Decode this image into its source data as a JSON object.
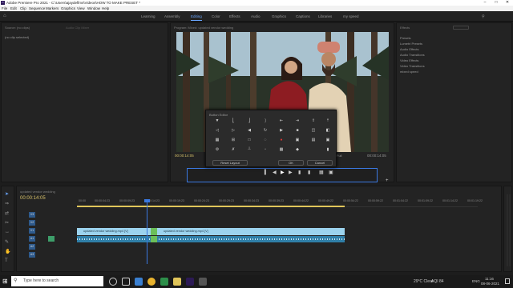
{
  "titlebar": {
    "title": "Adobe Premiere Pro 2021 - C:\\Users\\ajaydeflms\\Videos\\HOW TO MAKE PRESET *",
    "logo": "Pr",
    "controls": [
      "–",
      "□",
      "✕"
    ]
  },
  "menu": [
    "File",
    "Edit",
    "Clip",
    "Sequence",
    "Markers",
    "Graphics",
    "View",
    "Window",
    "Help"
  ],
  "workspaces": {
    "items": [
      "Learning",
      "Assembly",
      "Editing",
      "Color",
      "Effects",
      "Audio",
      "Graphics",
      "Captions",
      "Libraries",
      "my speed"
    ],
    "active": "Editing"
  },
  "source_panel": {
    "tabs": [
      "Source: (no clips)",
      "Audio Clip Mixer"
    ],
    "no_clip": "(no clip selected)"
  },
  "program_monitor": {
    "title": "Program: Mixed: updated vendor wedding",
    "timecode_left": "00:00:14:05",
    "timecode_right": "00:00:14:05",
    "fit": "Fit",
    "quality": "Full"
  },
  "effects_panel": {
    "title": "Effects",
    "items": [
      "Presets",
      "Lumetri Presets",
      "Audio Effects",
      "Audio Transitions",
      "Video Effects",
      "Video Transitions",
      "mixed speed"
    ]
  },
  "button_editor": {
    "title": "Button Editor",
    "reset_label": "Reset Layout",
    "ok_label": "OK",
    "cancel_label": "Cancel"
  },
  "timeline": {
    "tab": "updated vendor wedding",
    "timecode": "00:00:14:05",
    "ruler": [
      "00:00",
      "00:00:04:23",
      "00:00:09:23",
      "00:00:14:23",
      "00:00:19:23",
      "00:00:24:23",
      "00:00:29:23",
      "00:00:34:23",
      "00:00:39:23",
      "00:00:44:22",
      "00:00:49:22",
      "00:00:54:22",
      "00:00:59:22",
      "00:01:04:22",
      "00:01:09:22",
      "00:01:14:22",
      "00:01:19:22"
    ],
    "tracks": [
      "V3",
      "V2",
      "V1",
      "A1",
      "A2",
      "A3"
    ],
    "clip_a": "updated vendor wedding.mp4 [V]",
    "clip_b": "updated vendor wedding.mp4 [V]"
  },
  "taskbar": {
    "search_placeholder": "Type here to search",
    "weather": "29°C Clear",
    "aqi": "AQI 84",
    "lang": "ENG",
    "time": "11:16",
    "date": "08-06-2021"
  }
}
